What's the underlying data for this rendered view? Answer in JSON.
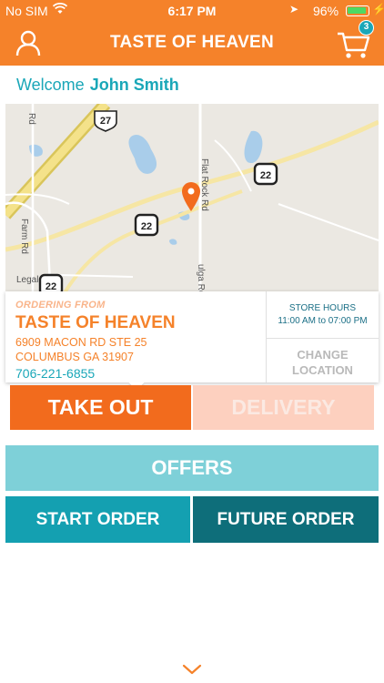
{
  "status_bar": {
    "carrier": "No SIM",
    "time": "6:17 PM",
    "battery": "96%"
  },
  "header": {
    "title": "TASTE OF HEAVEN",
    "cart_count": "3"
  },
  "welcome": {
    "greeting": "Welcome",
    "user_name": "John Smith"
  },
  "map": {
    "labels": {
      "flat_rock_rd": "Flat Rock Rd",
      "rd_top": "Rd",
      "farm_rd": "Farm Rd",
      "ulga_rd": "ulga Rd",
      "legal": "Legal",
      "shield_27": "27",
      "shield_22_a": "22",
      "shield_22_b": "22",
      "shield_22_c": "22"
    }
  },
  "store_card": {
    "ordering_from_label": "ORDERING FROM",
    "store_name": "TASTE OF HEAVEN",
    "address_line1": "6909 MACON RD STE 25",
    "address_line2": "COLUMBUS GA 31907",
    "phone": "706-221-6855",
    "hours_label": "STORE HOURS",
    "hours_value": "11:00 AM to 07:00 PM",
    "change_label_1": "CHANGE",
    "change_label_2": "LOCATION"
  },
  "buttons": {
    "take_out": "TAKE OUT",
    "delivery": "DELIVERY",
    "offers": "OFFERS",
    "start_order": "START ORDER",
    "future_order": "FUTURE ORDER"
  },
  "icons": {
    "user": "user-icon",
    "cart": "cart-icon",
    "map_pin": "map-pin-icon",
    "chevron": "chevron-down-icon",
    "wifi": "wifi-icon",
    "location": "location-arrow-icon"
  },
  "colors": {
    "brand_orange": "#f5822a",
    "accent_teal": "#1aa7b8",
    "dark_teal": "#0e6e7a"
  }
}
